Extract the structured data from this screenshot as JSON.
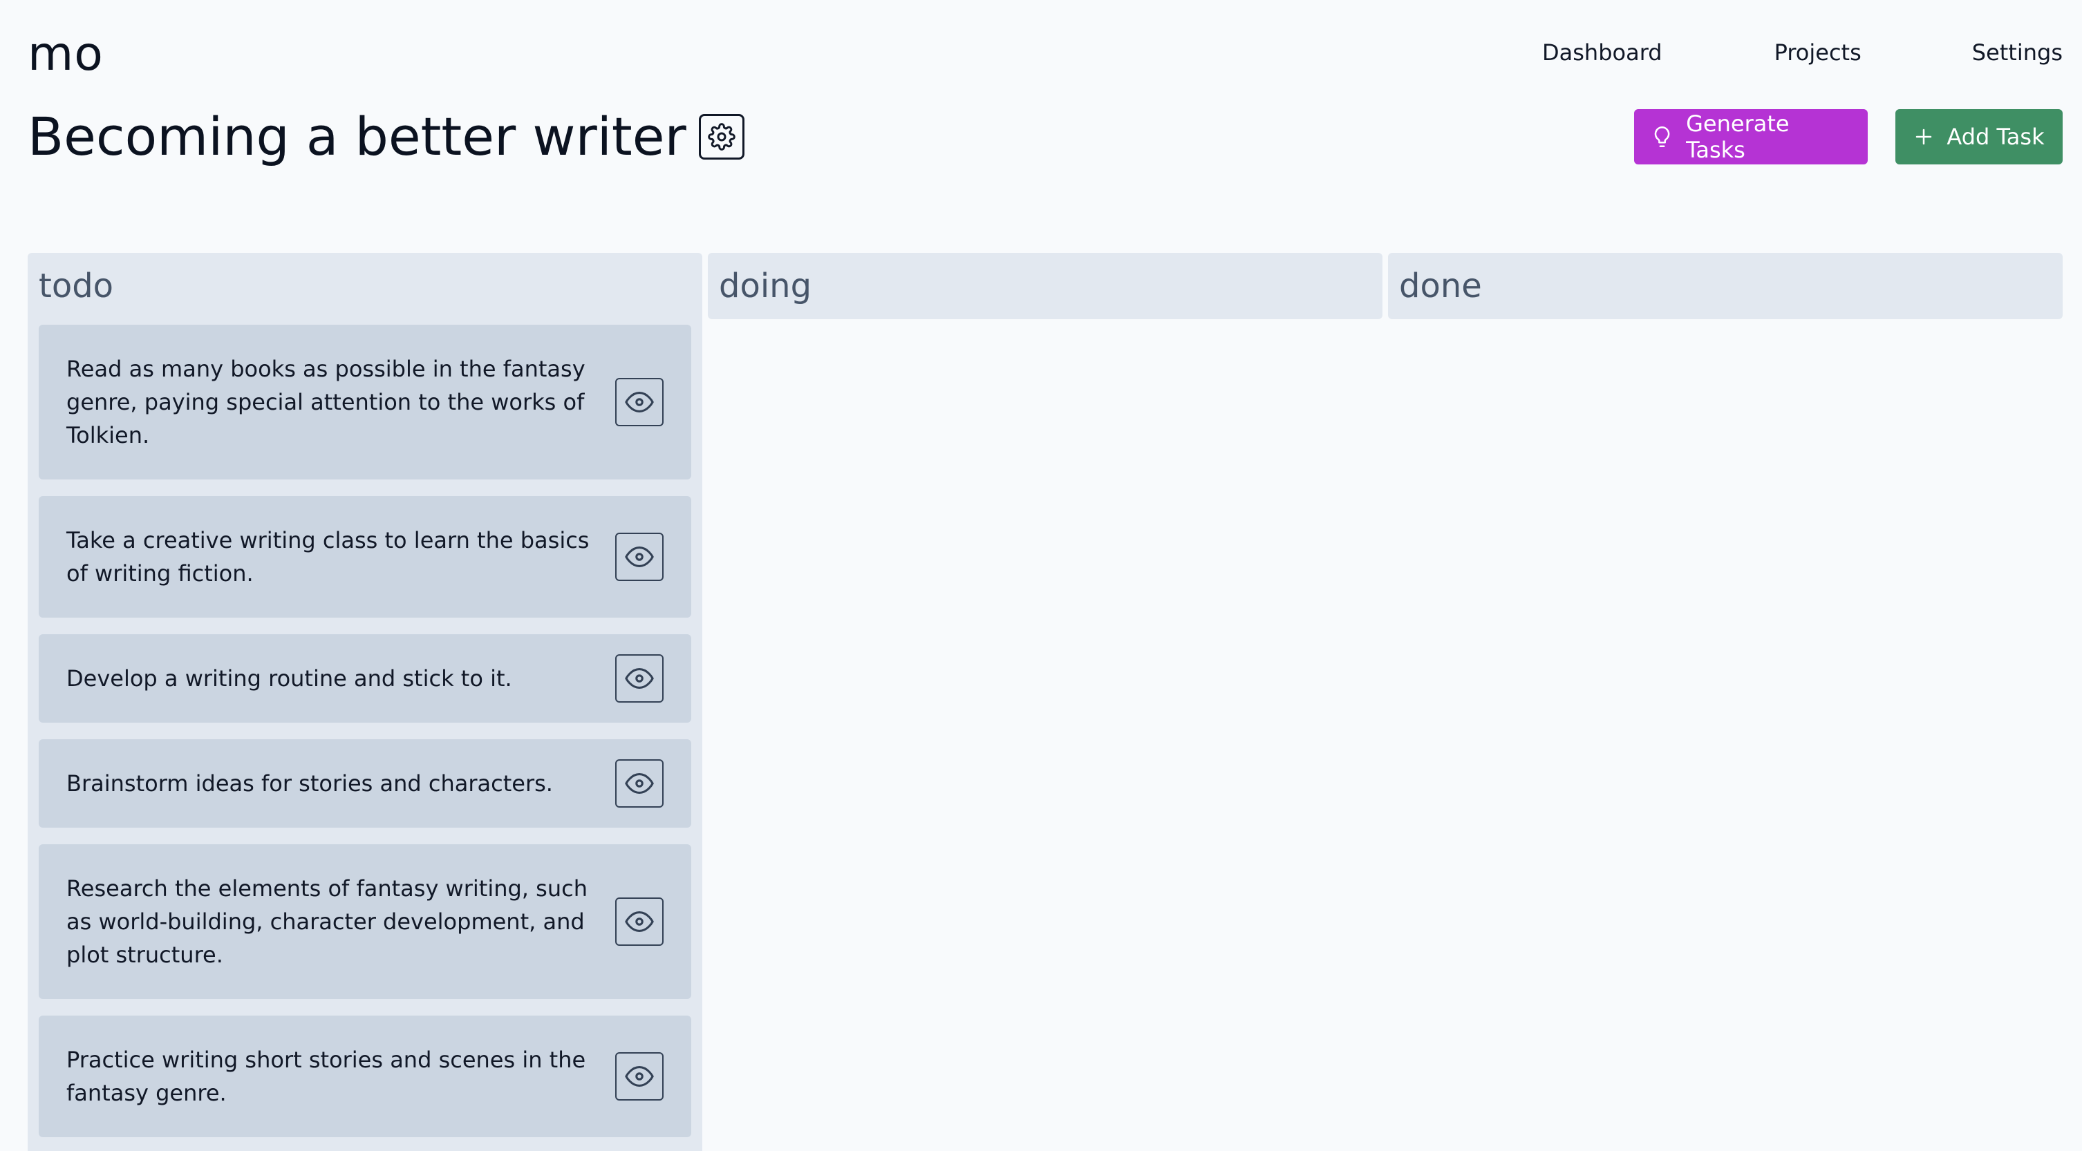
{
  "app": {
    "logo": "mo"
  },
  "nav": {
    "dashboard": "Dashboard",
    "projects": "Projects",
    "settings": "Settings"
  },
  "project": {
    "title": "Becoming a better writer"
  },
  "actions": {
    "generate_label": "Generate Tasks",
    "add_label": "Add Task"
  },
  "columns": {
    "todo": "todo",
    "doing": "doing",
    "done": "done"
  },
  "todo_cards": [
    "Read as many books as possible in the fantasy genre, paying special attention to the works of Tolkien.",
    "Take a creative writing class to learn the basics of writing fiction.",
    "Develop a writing routine and stick to it.",
    "Brainstorm ideas for stories and characters.",
    "Research the elements of fantasy writing, such as world-building, character development, and plot structure.",
    "Practice writing short stories and scenes in the fantasy genre."
  ],
  "colors": {
    "generate": "#b533d4",
    "add": "#3f8f64",
    "column_bg": "#e2e8f0",
    "card_bg": "#cbd5e1"
  },
  "icons": {
    "settings": "gear-icon",
    "generate": "lightbulb-icon",
    "add": "plus-icon",
    "view": "eye-icon"
  }
}
